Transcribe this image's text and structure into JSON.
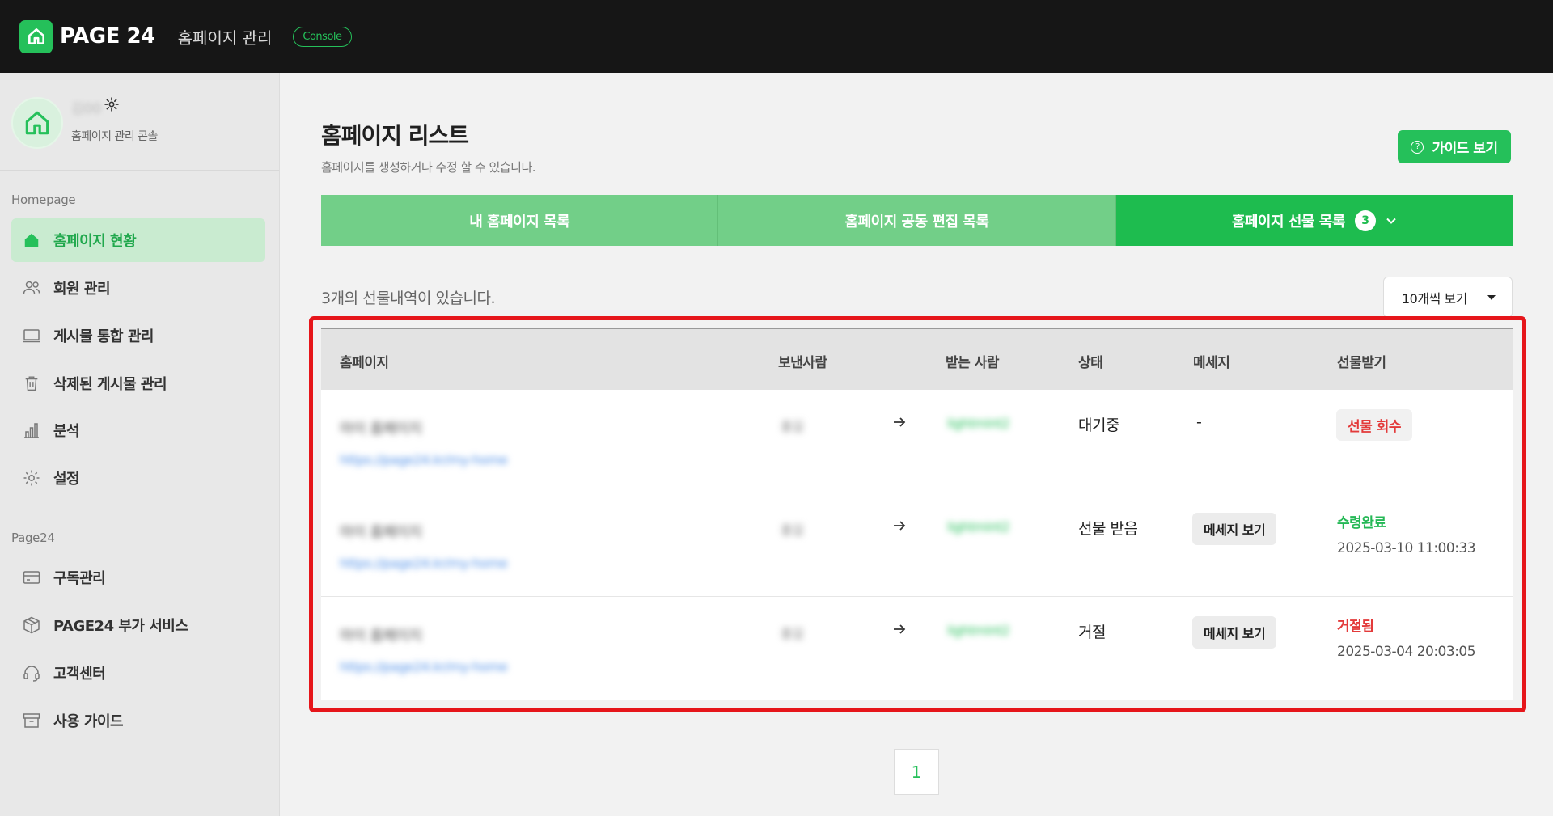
{
  "header": {
    "brand": "PAGE 24",
    "app_title": "홈페이지 관리",
    "console_label": "Console"
  },
  "profile": {
    "name": "김00",
    "subtitle": "홈페이지 관리 콘솔"
  },
  "sidebar": {
    "sections": [
      {
        "title": "Homepage",
        "items": [
          {
            "label": "홈페이지 현황",
            "icon": "home-icon",
            "active": true
          },
          {
            "label": "회원 관리",
            "icon": "users-icon"
          },
          {
            "label": "게시물 통합 관리",
            "icon": "monitor-icon"
          },
          {
            "label": "삭제된 게시물 관리",
            "icon": "trash-icon"
          },
          {
            "label": "분석",
            "icon": "bar-chart-icon"
          },
          {
            "label": "설정",
            "icon": "gear-icon"
          }
        ]
      },
      {
        "title": "Page24",
        "items": [
          {
            "label": "구독관리",
            "icon": "card-icon"
          },
          {
            "label": "PAGE24 부가 서비스",
            "icon": "box-icon"
          },
          {
            "label": "고객센터",
            "icon": "headset-icon"
          },
          {
            "label": "사용 가이드",
            "icon": "archive-icon"
          }
        ]
      }
    ]
  },
  "main": {
    "title": "홈페이지 리스트",
    "subtitle": "홈페이지를 생성하거나 수정 할 수 있습니다.",
    "guide_button": "가이드 보기",
    "tabs": [
      {
        "label": "내 홈페이지 목록"
      },
      {
        "label": "홈페이지 공동 편집 목록"
      },
      {
        "label": "홈페이지 선물 목록",
        "count": "3",
        "active": true
      }
    ],
    "summary": "3개의 선물내역이 있습니다.",
    "per_page": "10개씩 보기",
    "table": {
      "headers": [
        "홈페이지",
        "보낸사람",
        "받는 사람",
        "상태",
        "메세지",
        "선물받기"
      ],
      "rows": [
        {
          "site_name": "마이 홈페이지",
          "site_url": "https://page24.kr/my-home",
          "sender": "홍길",
          "receiver": "lightmint2",
          "status": "대기중",
          "message": "-",
          "action": "선물 회수"
        },
        {
          "site_name": "마이 홈페이지",
          "site_url": "https://page24.kr/my-home",
          "sender": "홍길",
          "receiver": "lightmint2",
          "status": "선물 받음",
          "message": "메세지 보기",
          "result": "수령완료",
          "timestamp": "2025-03-10 11:00:33"
        },
        {
          "site_name": "마이 홈페이지",
          "site_url": "https://page24.kr/my-home",
          "sender": "홍길",
          "receiver": "lightmint2",
          "status": "거절",
          "message": "메세지 보기",
          "result": "거절됨",
          "timestamp": "2025-03-04 20:03:05"
        }
      ]
    },
    "pagination": {
      "current": "1"
    }
  },
  "colors": {
    "brand_green": "#25c05a",
    "tab_light": "#72cf88",
    "highlight_red": "#e6161b",
    "reject_red": "#e33a3a"
  }
}
